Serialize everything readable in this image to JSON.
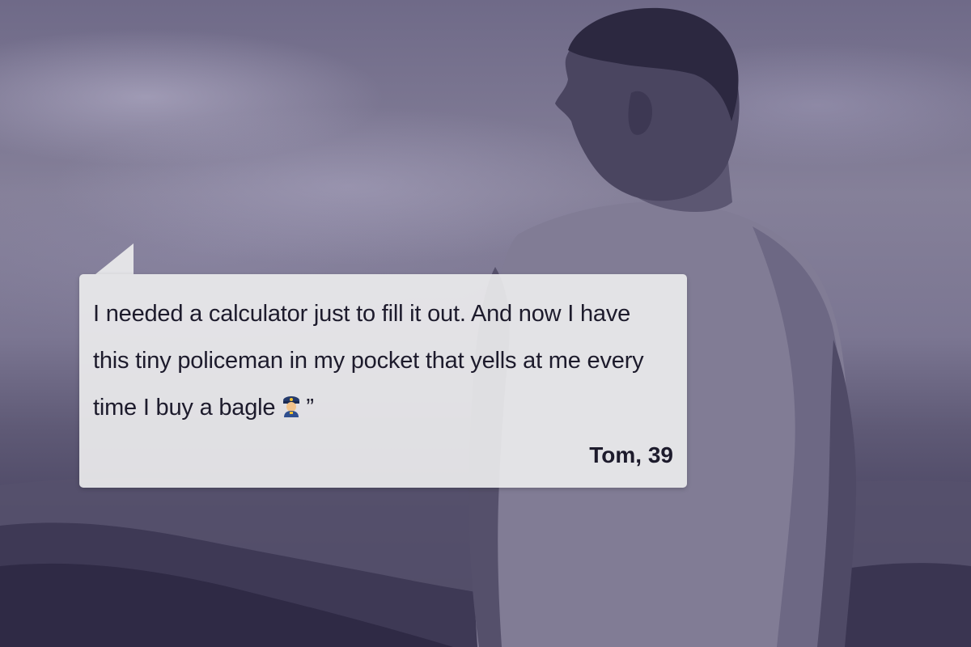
{
  "quote": {
    "text": "I needed a calculator just to fill it out. And now I have this tiny policeman in my pocket that yells at me every time I buy a bagle",
    "emoji_icon": "police-officer-icon",
    "closing_mark": "”",
    "author": "Tom, 39"
  },
  "colors": {
    "tint": "#5e5975",
    "card": "#ecebed",
    "text": "#1d1b2c"
  }
}
